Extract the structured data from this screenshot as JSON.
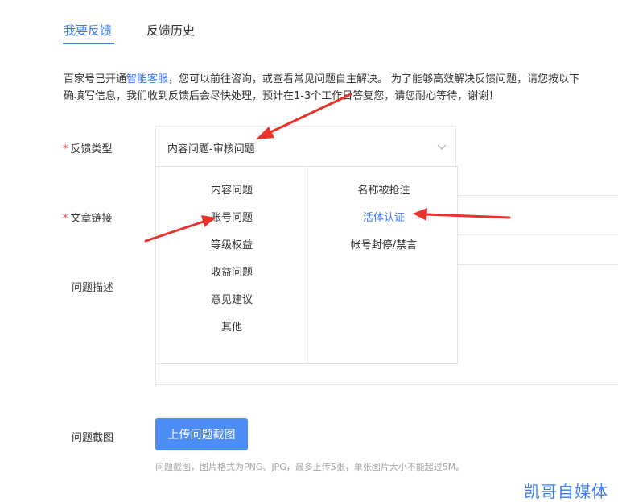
{
  "tabs": [
    {
      "label": "我要反馈",
      "active": true
    },
    {
      "label": "反馈历史",
      "active": false
    }
  ],
  "notice": {
    "line1_prefix": "百家号已开通",
    "line1_link": "智能客服",
    "line1_suffix": "，您可以前往咨询，或查看常见问题自主解决。 为了能够高效解决反馈问题，请您按以下",
    "line2": "确填写信息，我们收到反馈后会尽快处理，预计在1-3个工作日答复您，请您耐心等待，谢谢！"
  },
  "form": {
    "required_mark": "*",
    "type_label": "反馈类型",
    "link_label": "文章链接",
    "desc_label": "问题描述",
    "screenshot_label": "问题截图",
    "type_value": "内容问题-审核问题",
    "upload_button": "上传问题截图",
    "upload_hint": "问题截图，图片格式为PNG、JPG，最多上传5张，单张图片大小不能超过5M。"
  },
  "dropdown": {
    "left_items": [
      "内容问题",
      "账号问题",
      "等级权益",
      "收益问题",
      "意见建议",
      "其他"
    ],
    "right_items": [
      "名称被抢注",
      "活体认证",
      "帐号封停/禁言"
    ],
    "active_right_index": 1
  },
  "watermark": "凯哥自媒体",
  "colors": {
    "accent": "#3c7cf6",
    "button": "#4c8cf5",
    "required": "#e84a3c",
    "annotation_arrow": "#e8322b"
  },
  "icons": {
    "select_chevron": "chevron-down-icon"
  }
}
